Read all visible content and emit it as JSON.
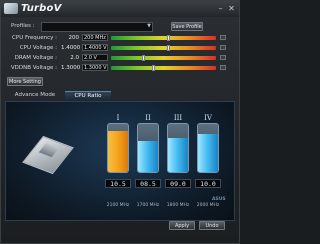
{
  "window": {
    "title": "TurboV"
  },
  "profiles": {
    "label": "Profiles :",
    "selected": "",
    "save_button": "Save Profile"
  },
  "params": [
    {
      "name": "CPU Frequency :",
      "value": "200",
      "box": "200 MHz",
      "level": 0.55
    },
    {
      "name": "CPU Voltage :",
      "value": "1.4000",
      "box": "1.4000 V",
      "level": 0.55
    },
    {
      "name": "DRAM Voltage :",
      "value": "2.0",
      "box": "2.0 V",
      "level": 0.3
    },
    {
      "name": "VDDNB Voltage :",
      "value": "1.3000",
      "box": "1.3000 V",
      "level": 0.4
    }
  ],
  "more_setting": "More Setting",
  "tabs": [
    {
      "label": "Advance Mode",
      "active": false
    },
    {
      "label": "CPU Ratio",
      "active": true
    }
  ],
  "cores": [
    {
      "numeral": "I",
      "ratio": "10.5",
      "freq": "2100 MHz",
      "level": 0.85,
      "color": "#f7a31b"
    },
    {
      "numeral": "II",
      "ratio": "08.5",
      "freq": "1700 MHz",
      "level": 0.65,
      "color": "#3fb8ef"
    },
    {
      "numeral": "III",
      "ratio": "09.0",
      "freq": "1800 MHz",
      "level": 0.7,
      "color": "#3fb8ef"
    },
    {
      "numeral": "IV",
      "ratio": "10.0",
      "freq": "2000 MHz",
      "level": 0.8,
      "color": "#3fb8ef"
    }
  ],
  "brand": "ASUS",
  "apply_button": "Apply",
  "undo_button": "Undo",
  "icons": {
    "logo": "turbov-logo",
    "minimize": "minimize-icon",
    "close": "close-icon",
    "cpu": "cpu-chip-icon"
  }
}
